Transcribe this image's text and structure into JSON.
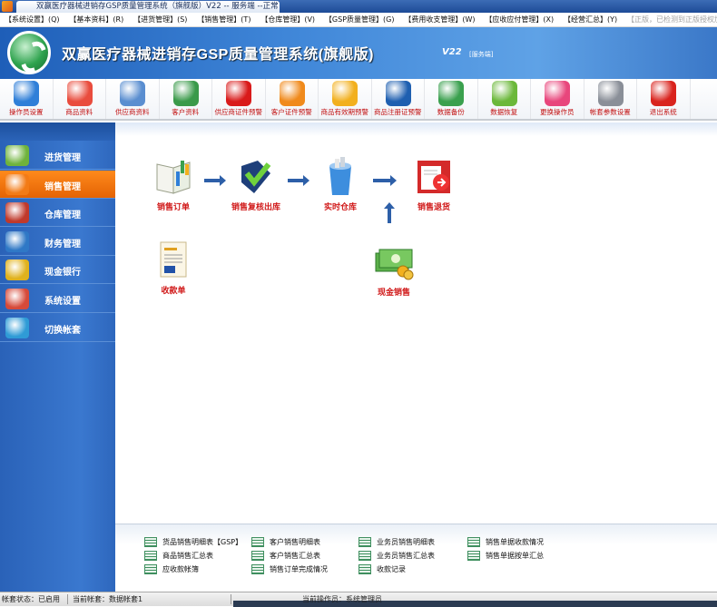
{
  "window": {
    "title": "双赢医疗器械进销存GSP质量管理系统（旗舰版）V22 -- 服务端 --正常"
  },
  "menu": [
    {
      "label": "【系统设置】(Q)"
    },
    {
      "label": "【基本资料】(R)"
    },
    {
      "label": "【进货管理】(S)"
    },
    {
      "label": "【销售管理】(T)"
    },
    {
      "label": "【仓库管理】(V)"
    },
    {
      "label": "【GSP质量管理】(G)"
    },
    {
      "label": "【费用收支管理】(W)"
    },
    {
      "label": "【应收应付管理】(X)"
    },
    {
      "label": "【经营汇总】(Y)"
    },
    {
      "label": "【正版，已检测到正版授权加密锁】(Z)"
    }
  ],
  "banner": {
    "title": "双赢医疗器械进销存GSP质量管理系统(旗舰版)",
    "version": "V22",
    "server": "[服务端]"
  },
  "toolbar": [
    {
      "label": "操作员设置",
      "icon": "operator-settings-icon",
      "color": "#2f7fd8"
    },
    {
      "label": "商品资料",
      "icon": "product-chart-icon",
      "color": "#e94c3d"
    },
    {
      "label": "供应商资料",
      "icon": "supplier-card-icon",
      "color": "#5a8ed0"
    },
    {
      "label": "客户资料",
      "icon": "customer-users-icon",
      "color": "#3a9a4a"
    },
    {
      "label": "供应商证件预警",
      "icon": "info-warning-icon",
      "color": "#d91a1a"
    },
    {
      "label": "客户证件预警",
      "icon": "rss-alert-icon",
      "color": "#f08a1c"
    },
    {
      "label": "商品有效期预警",
      "icon": "warning-triangle-icon",
      "color": "#f2b01e"
    },
    {
      "label": "商品注册证预警",
      "icon": "credit-card-icon",
      "color": "#1e5fb0"
    },
    {
      "label": "数据备份",
      "icon": "floppy-disk-icon",
      "color": "#3aa04e"
    },
    {
      "label": "数据恢复",
      "icon": "restore-cycle-icon",
      "color": "#6bb83a"
    },
    {
      "label": "更换操作员",
      "icon": "switch-user-icon",
      "color": "#e8467c"
    },
    {
      "label": "帐套参数设置",
      "icon": "gear-icon",
      "color": "#8a8f98"
    },
    {
      "label": "退出系统",
      "icon": "power-icon",
      "color": "#d9231d"
    }
  ],
  "sidebar": [
    {
      "label": "进货管理",
      "icon": "basket-icon",
      "color": "#6fb33c",
      "active": false
    },
    {
      "label": "销售管理",
      "icon": "sales-arrows-icon",
      "color": "#f37b16",
      "active": true
    },
    {
      "label": "仓库管理",
      "icon": "warehouse-icon",
      "color": "#c0392b",
      "active": false
    },
    {
      "label": "财务管理",
      "icon": "finance-chart-icon",
      "color": "#2f78c6",
      "active": false
    },
    {
      "label": "现金银行",
      "icon": "cash-icon",
      "color": "#e0b21e",
      "active": false
    },
    {
      "label": "系统设置",
      "icon": "system-settings-icon",
      "color": "#d64a3a",
      "active": false
    },
    {
      "label": "切换帐套",
      "icon": "cloud-switch-icon",
      "color": "#2f9bd6",
      "active": false
    }
  ],
  "flow": {
    "sales_order": "销售订单",
    "sales_review": "销售复核出库",
    "realtime_stock": "实时仓库",
    "sales_return": "销售退货",
    "receipt": "收款单",
    "cash_sales": "现金销售"
  },
  "reports": [
    {
      "label": "货品销售明细表【GSP】"
    },
    {
      "label": "客户销售明细表"
    },
    {
      "label": "业务员销售明细表"
    },
    {
      "label": "销售单据收款情况"
    },
    {
      "label": "商品销售汇总表"
    },
    {
      "label": "客户销售汇总表"
    },
    {
      "label": "业务员销售汇总表"
    },
    {
      "label": "销售单据按单汇总"
    },
    {
      "label": "应收款帐簿"
    },
    {
      "label": "销售订单完成情况"
    },
    {
      "label": "收款记录"
    }
  ],
  "status": {
    "account_state": "帐套状态：已启用",
    "current_account": "当前帐套：数据帐套1",
    "current_operator": "当前操作员：系统管理员"
  }
}
